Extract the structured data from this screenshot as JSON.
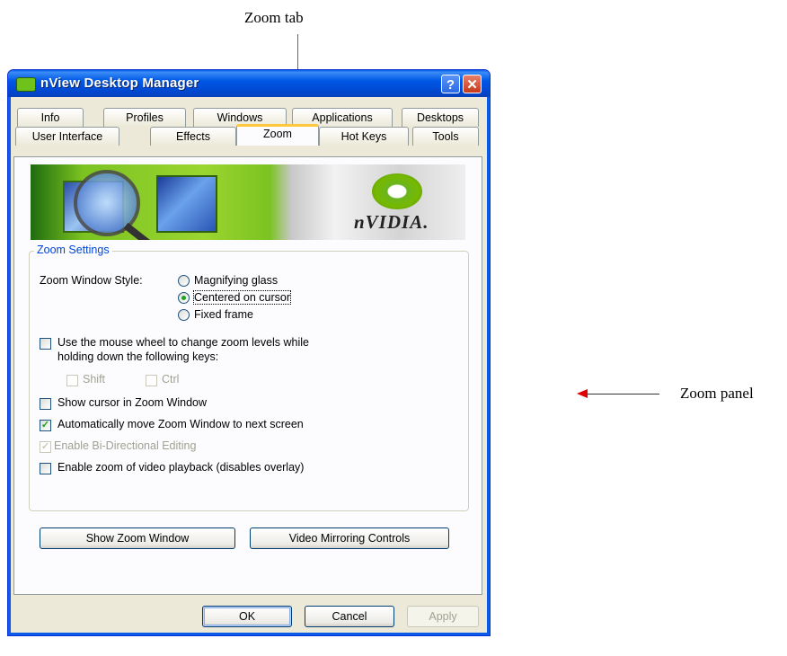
{
  "callouts": {
    "zoom_tab": "Zoom tab",
    "zoom_panel": "Zoom panel"
  },
  "window": {
    "title": "nView Desktop Manager",
    "help_label": "?",
    "close_label": "✕"
  },
  "tabs": {
    "row1": [
      "Info",
      "Profiles",
      "Windows",
      "Applications",
      "Desktops"
    ],
    "row2": [
      "User Interface",
      "Effects",
      "Zoom",
      "Hot Keys",
      "Tools"
    ],
    "active": "Zoom"
  },
  "banner": {
    "brand": "nVIDIA."
  },
  "zoom_settings": {
    "group_label": "Zoom Settings",
    "style_label": "Zoom Window Style:",
    "style_options": [
      "Magnifying glass",
      "Centered on cursor",
      "Fixed frame"
    ],
    "style_selected": "Centered on cursor",
    "mouse_wheel_line1": "Use the mouse wheel to change zoom levels while",
    "mouse_wheel_line2": "holding down the following keys:",
    "mouse_wheel_checked": false,
    "shift_label": "Shift",
    "ctrl_label": "Ctrl",
    "show_cursor_label": "Show cursor in Zoom Window",
    "show_cursor_checked": false,
    "auto_move_label": "Automatically move Zoom Window to next screen",
    "auto_move_checked": true,
    "bidirectional_label": "Enable Bi-Directional Editing",
    "bidirectional_checked": true,
    "video_zoom_label": "Enable zoom of video playback (disables overlay)",
    "video_zoom_checked": false
  },
  "buttons": {
    "show_zoom_window": "Show Zoom Window",
    "video_mirroring": "Video Mirroring Controls",
    "ok": "OK",
    "cancel": "Cancel",
    "apply": "Apply"
  }
}
